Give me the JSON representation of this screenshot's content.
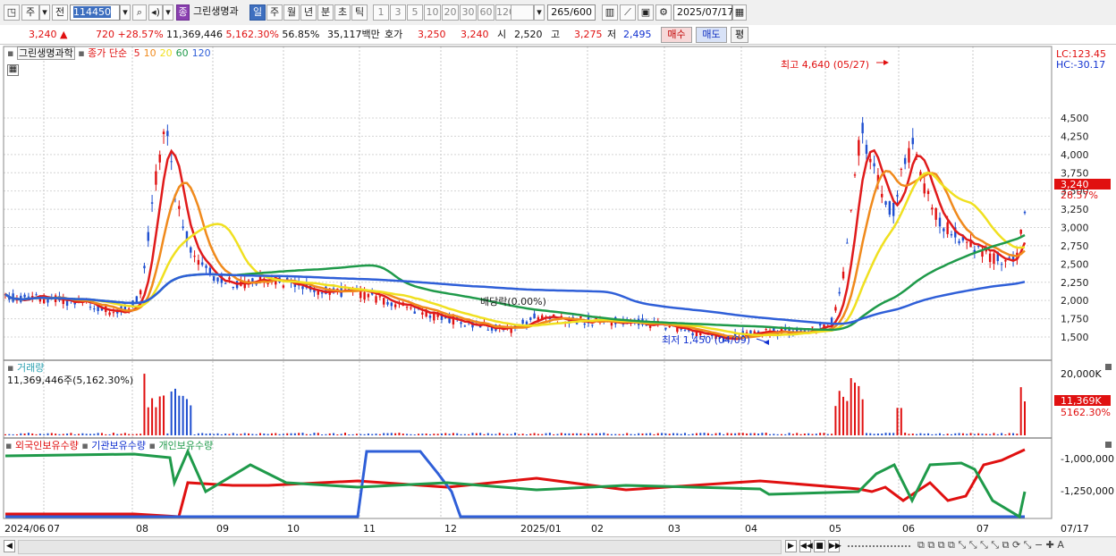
{
  "toolbar": {
    "market_label": "주",
    "prev_label": "전",
    "stock_code": "114450",
    "stock_name": "그린생명과",
    "badge_label": "종",
    "periods": [
      "일",
      "주",
      "월",
      "년",
      "분",
      "초",
      "틱"
    ],
    "intervals": [
      "1",
      "3",
      "5",
      "10",
      "20",
      "30",
      "60",
      "120"
    ],
    "count": "265",
    "count_total": "/600",
    "date": "2025/07/17"
  },
  "quote": {
    "price": "3,240",
    "change_arrow": "▲",
    "change": "720",
    "change_pct": "+28.57%",
    "volume": "11,369,446",
    "volume_pct": "5,162.30%",
    "turnover_pct": "56.85%",
    "amount": "35,117백만",
    "hoga_label": "호가",
    "hoga_ask": "3,250",
    "hoga_bid": "3,240",
    "open_label": "시",
    "open": "2,520",
    "high_label": "고",
    "high": "3,275",
    "low_label": "저",
    "low": "2,495",
    "buy_label": "매수",
    "sell_label": "매도",
    "eval_label": "평"
  },
  "price_pane": {
    "stock_tag": "그린생명과학",
    "ma_title": "종가 단순",
    "ma_periods": [
      {
        "value": "5",
        "color": "#e01b1b"
      },
      {
        "value": "10",
        "color": "#f08a1c"
      },
      {
        "value": "20",
        "color": "#f0e020"
      },
      {
        "value": "60",
        "color": "#1f9a4a"
      },
      {
        "value": "120",
        "color": "#2f5fd8"
      }
    ],
    "lc": "LC:123.45",
    "hc": "HC:-30.17",
    "high_note": "최고 4,640 (05/27)",
    "low_note": "최저 1,450 (04/09)",
    "dividend_note": "배당락(0.00%)",
    "price_tag": "3,240",
    "pct_tag": "28.57%",
    "y_ticks": [
      "4,500",
      "4,250",
      "4,000",
      "3,750",
      "3,500",
      "3,250",
      "3,000",
      "2,750",
      "2,500",
      "2,250",
      "2,000",
      "1,750",
      "1,500"
    ]
  },
  "volume_pane": {
    "title": "거래량",
    "value": "11,369,446주(5,162.30%)",
    "axis_max": "20,000K",
    "vol_tag": "11,369K",
    "pct_tag": "5162.30%"
  },
  "holding_pane": {
    "foreign": "외국인보유수량",
    "inst": "기관보유수량",
    "indiv": "개인보유수량",
    "ticks": [
      "-1,000,000",
      "-1,250,000"
    ]
  },
  "xaxis": {
    "labels": [
      {
        "text": "2024/06",
        "x": 5
      },
      {
        "text": "07",
        "x": 53
      },
      {
        "text": "08",
        "x": 152
      },
      {
        "text": "09",
        "x": 242
      },
      {
        "text": "10",
        "x": 321
      },
      {
        "text": "11",
        "x": 406
      },
      {
        "text": "12",
        "x": 497
      },
      {
        "text": "2025/01",
        "x": 582
      },
      {
        "text": "02",
        "x": 661
      },
      {
        "text": "03",
        "x": 747
      },
      {
        "text": "04",
        "x": 833
      },
      {
        "text": "05",
        "x": 927
      },
      {
        "text": "06",
        "x": 1009
      },
      {
        "text": "07",
        "x": 1092
      }
    ],
    "right_label": "07/17"
  },
  "chart_data": {
    "type": "candlestick",
    "title": "그린생명과학",
    "x_range": [
      "2024/06",
      "2025/07/17"
    ],
    "ylim": [
      1450,
      4640
    ],
    "last": {
      "open": 2520,
      "high": 3275,
      "low": 2495,
      "close": 3240
    },
    "ma_periods": [
      5,
      10,
      20,
      60,
      120
    ]
  }
}
